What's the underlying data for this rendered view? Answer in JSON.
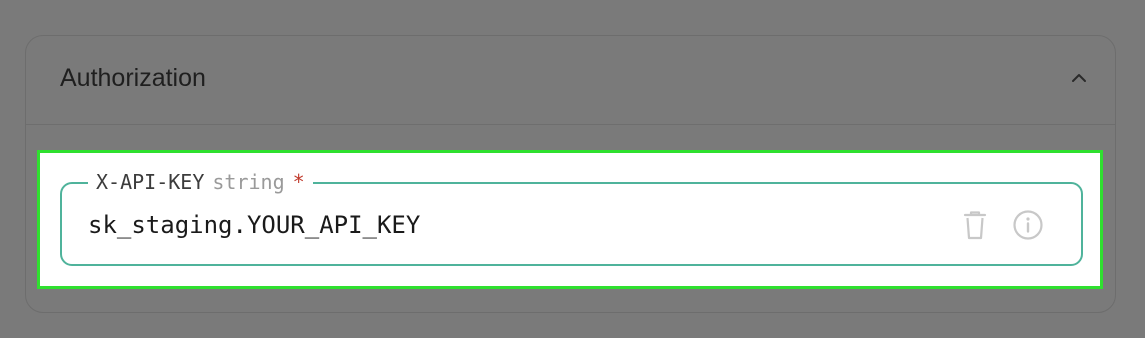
{
  "section": {
    "title": "Authorization",
    "collapse_icon": "chevron-up-icon"
  },
  "field": {
    "name": "X-API-KEY",
    "type": "string",
    "required_marker": "*",
    "value": "sk_staging.YOUR_API_KEY",
    "delete_icon": "trash-icon",
    "info_icon": "info-icon"
  },
  "colors": {
    "backdrop": "#7a7a7a",
    "highlight": "#2fe02f",
    "field_border": "#4fb39b",
    "required": "#c0392b"
  }
}
